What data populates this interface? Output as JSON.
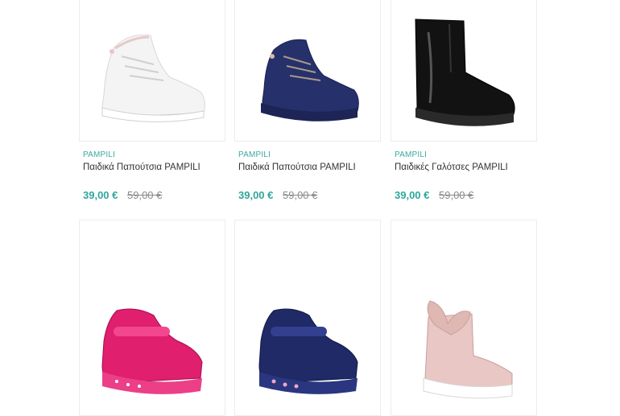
{
  "products": [
    {
      "brand": "PAMPILI",
      "title": "Παιδικά Παπούτσια PAMPILI",
      "price": "39,00 €",
      "old_price": "59,00 €",
      "image": "white-sneaker"
    },
    {
      "brand": "PAMPILI",
      "title": "Παιδικά Παπούτσια PAMPILI",
      "price": "39,00 €",
      "old_price": "59,00 €",
      "image": "navy-sneaker"
    },
    {
      "brand": "PAMPILI",
      "title": "Παιδικές Γαλότσες PAMPILI",
      "price": "39,00 €",
      "old_price": "59,00 €",
      "image": "black-patent-boot"
    },
    {
      "image": "pink-patent-sneaker"
    },
    {
      "image": "navy-patent-sneaker"
    },
    {
      "image": "pink-bow-boot"
    }
  ],
  "colors": {
    "accent": "#2fa69c",
    "brand": "#3aa9a0",
    "old_price": "#8a8a8a"
  }
}
